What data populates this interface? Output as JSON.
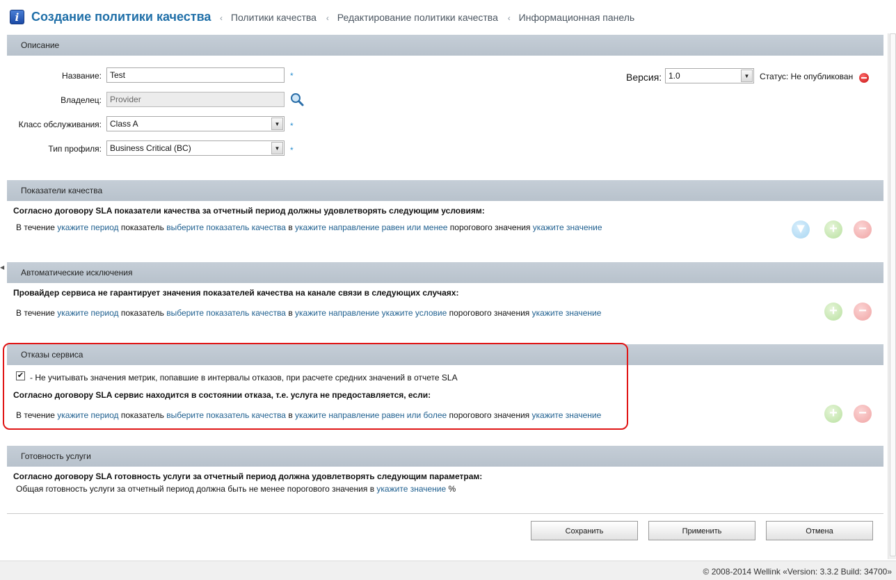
{
  "header": {
    "icon": "info-icon",
    "icon_glyph": "i",
    "title": "Создание политики качества",
    "breadcrumbs": [
      "Политики качества",
      "Редактирование политики качества",
      "Информационная панель"
    ]
  },
  "description": {
    "title": "Описание",
    "name_label": "Название:",
    "name_value": "Test",
    "owner_label": "Владелец:",
    "owner_value": "Provider",
    "class_label": "Класс обслуживания:",
    "class_value": "Class A",
    "profile_label": "Тип профиля:",
    "profile_value": "Business Critical (BC)",
    "required_mark": "*",
    "version_label": "Версия:",
    "version_value": "1.0",
    "status_text": "Статус: Не опубликован"
  },
  "quality": {
    "title": "Показатели качества",
    "intro": "Согласно договору SLA показатели качества за отчетный период должны удовлетворять следующим условиям:",
    "rule": {
      "t1": "В течение ",
      "period": "укажите период",
      "t2": " показатель ",
      "metric": "выберите показатель качества",
      "t3": " в ",
      "direction": "укажите направление равен или менее",
      "t4": " порогового значения ",
      "value": "укажите значение"
    }
  },
  "exceptions": {
    "title": "Автоматические исключения",
    "intro": "Провайдер сервиса не гарантирует значения показателей качества на канале связи в следующих случаях:",
    "rule": {
      "t1": "В течение ",
      "period": "укажите период",
      "t2": " показатель ",
      "metric": "выберите показатель качества",
      "t3": " в ",
      "direction": "укажите направление укажите условие",
      "t4": " порогового значения ",
      "value": "укажите значение"
    }
  },
  "failures": {
    "title": "Отказы сервиса",
    "checkbox_checked": true,
    "checkbox_label": "- Не учитывать значения метрик, попавшие в интервалы отказов, при расчете средних значений в отчете SLA",
    "intro": "Согласно договору SLA сервис находится в состоянии отказа, т.е. услуга не предоставляется, если:",
    "rule": {
      "t1": "В течение ",
      "period": "укажите период",
      "t2": " показатель ",
      "metric": "выберите показатель качества",
      "t3": " в ",
      "direction": "укажите направление равен или более",
      "t4": " порогового значения ",
      "value": "укажите значение"
    }
  },
  "availability": {
    "title": "Готовность услуги",
    "intro": "Согласно договору SLA готовность услуги за отчетный период должна удовлетворять следующим параметрам:",
    "t1": "Общая готовность услуги за отчетный период должна быть не менее порогового значения в ",
    "value": "укажите значение",
    "unit": " %"
  },
  "buttons": {
    "save": "Сохранить",
    "apply": "Применить",
    "cancel": "Отмена"
  },
  "footer": {
    "text": "© 2008-2014 Wellink «Version: 3.3.2 Build: 34700»"
  },
  "colors": {
    "title": "#1f6fa8",
    "link": "#1e5f8f",
    "panel_header": "#c0c9d2",
    "highlight_frame": "#e01515"
  }
}
